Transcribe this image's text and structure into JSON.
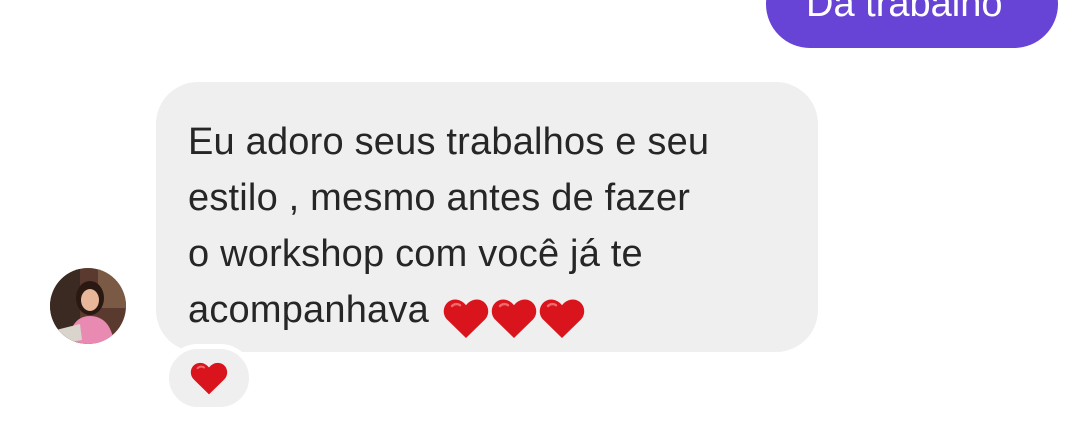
{
  "sent_message": {
    "text": "Dá trabalho",
    "bubble_color": "#6743d6"
  },
  "received_message": {
    "text": "Eu adoro seus trabalhos e seu\nestilo , mesmo antes de fazer\no workshop com você já te\nacompanhava",
    "emoji_hearts": [
      "heart-icon",
      "heart-icon",
      "heart-icon"
    ],
    "bubble_color": "#efefef",
    "text_color": "#262626"
  },
  "avatar": {
    "icon": "profile-photo"
  },
  "reaction": {
    "icon": "heart-icon",
    "color": "#e0161f"
  }
}
